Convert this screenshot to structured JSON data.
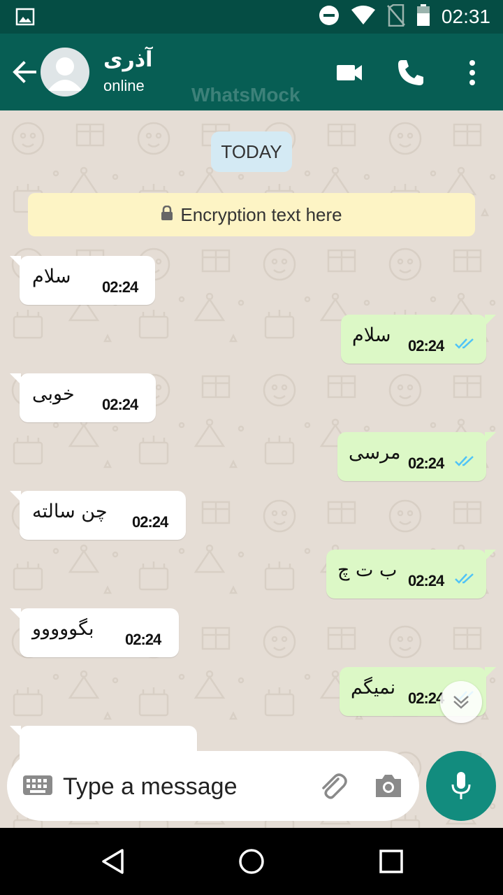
{
  "status_bar": {
    "time": "02:31",
    "icons": [
      "gallery-icon",
      "do-not-disturb-icon",
      "wifi-icon",
      "no-sim-icon",
      "battery-icon"
    ]
  },
  "header": {
    "contact_name": "آذری",
    "contact_status": "online",
    "watermark": "WhatsMock",
    "actions": [
      "video-call-icon",
      "phone-icon",
      "more-vert-icon"
    ]
  },
  "chat": {
    "date_label": "TODAY",
    "encryption_text": "Encryption text here",
    "messages": [
      {
        "direction": "incoming",
        "text": "سلام",
        "time": "02:24"
      },
      {
        "direction": "outgoing",
        "text": "سلام",
        "time": "02:24",
        "status": "read"
      },
      {
        "direction": "incoming",
        "text": "خوبی",
        "time": "02:24"
      },
      {
        "direction": "outgoing",
        "text": "مرسی",
        "time": "02:24",
        "status": "read"
      },
      {
        "direction": "incoming",
        "text": "چن سالته",
        "time": "02:24"
      },
      {
        "direction": "outgoing",
        "text": "ب ت چ",
        "time": "02:24",
        "status": "read"
      },
      {
        "direction": "incoming",
        "text": "بگووووو",
        "time": "02:24"
      },
      {
        "direction": "outgoing",
        "text": "نمیگم",
        "time": "02:24",
        "status": "read"
      }
    ]
  },
  "composer": {
    "placeholder": "Type a message",
    "icons": [
      "keyboard-icon",
      "attach-icon",
      "camera-icon",
      "mic-icon"
    ]
  },
  "colors": {
    "status_bar": "#054d44",
    "app_bar": "#075e54",
    "chat_bg": "#e5ddd5",
    "outgoing_bubble": "#dcf8c6",
    "incoming_bubble": "#ffffff",
    "read_ticks": "#4fc3f7",
    "mic_button": "#128c7e"
  }
}
